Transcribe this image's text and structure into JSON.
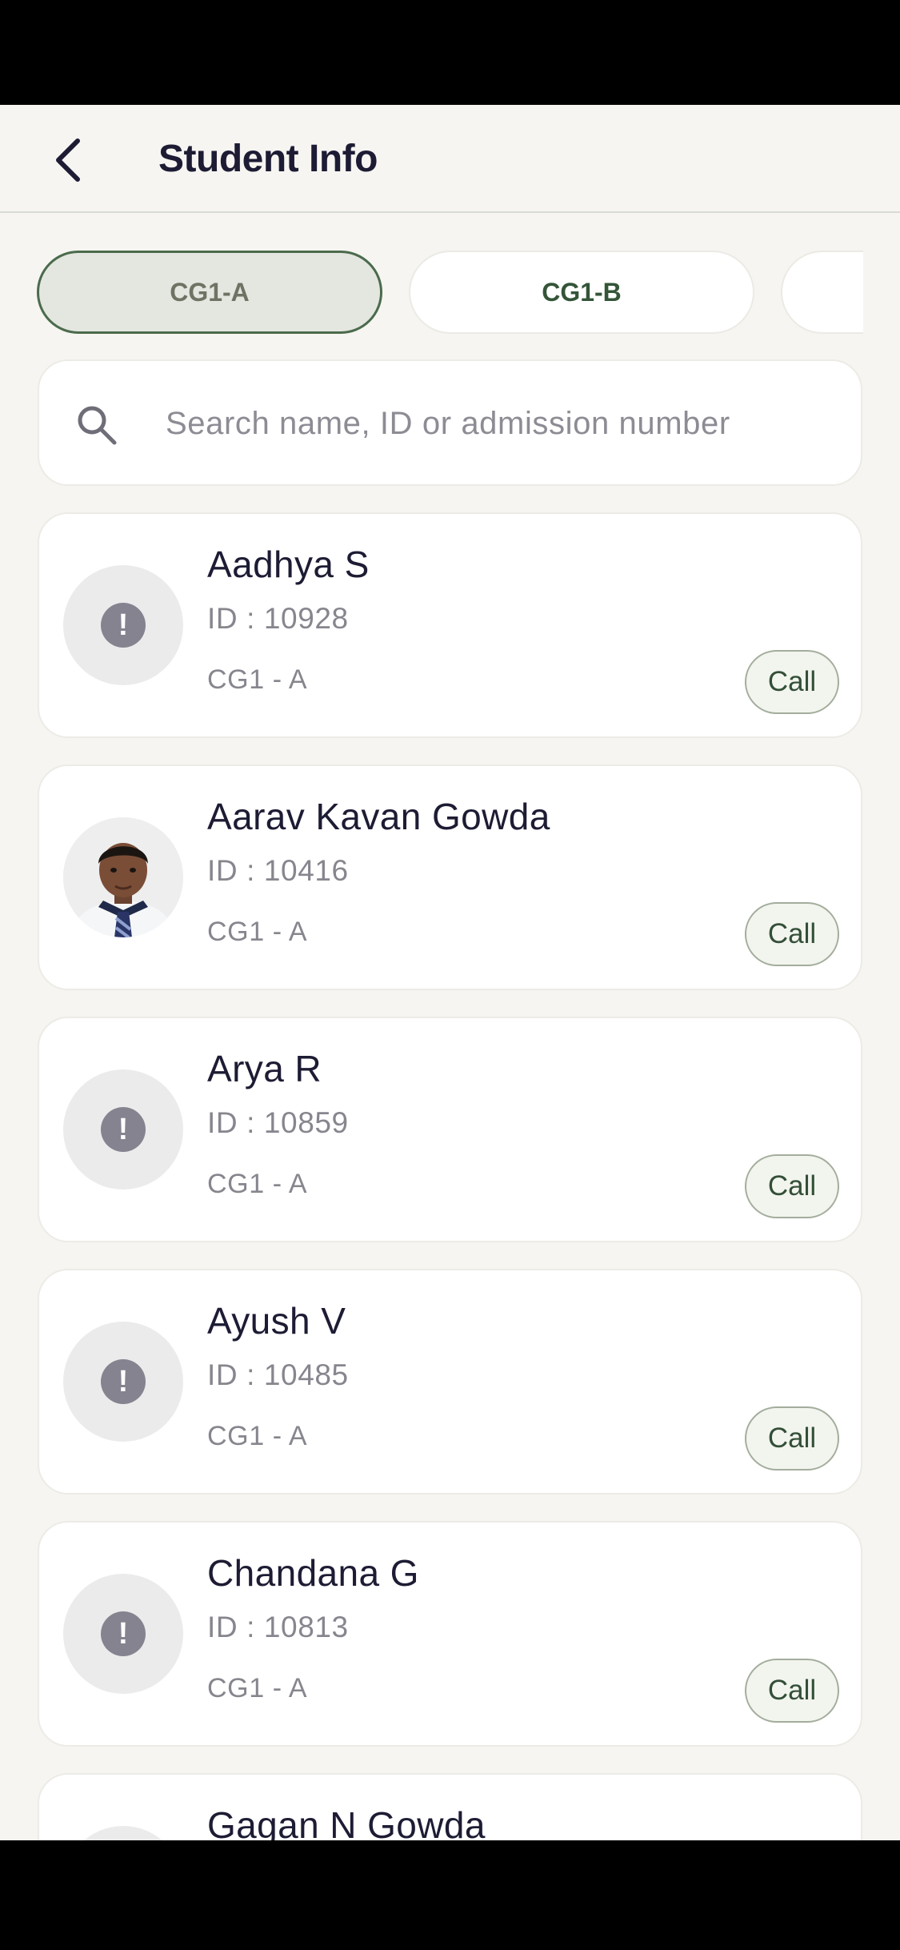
{
  "header": {
    "title": "Student Info",
    "back_icon": "chevron-left-icon"
  },
  "tabs": [
    {
      "label": "CG1-A",
      "selected": true
    },
    {
      "label": "CG1-B",
      "selected": false
    },
    {
      "label": "",
      "selected": false
    }
  ],
  "search": {
    "placeholder": "Search name, ID or admission number",
    "value": "",
    "icon": "search-icon"
  },
  "students": [
    {
      "name": "Aadhya S",
      "id_text": "ID : 10928",
      "class_text": "CG1 - A",
      "avatar": "alert-icon",
      "call_label": "Call"
    },
    {
      "name": "Aarav Kavan Gowda",
      "id_text": "ID : 10416",
      "class_text": "CG1 - A",
      "avatar": "photo",
      "call_label": "Call"
    },
    {
      "name": "Arya R",
      "id_text": "ID : 10859",
      "class_text": "CG1 - A",
      "avatar": "alert-icon",
      "call_label": "Call"
    },
    {
      "name": "Ayush V",
      "id_text": "ID : 10485",
      "class_text": "CG1 - A",
      "avatar": "alert-icon",
      "call_label": "Call"
    },
    {
      "name": "Chandana G",
      "id_text": "ID : 10813",
      "class_text": "CG1 - A",
      "avatar": "alert-icon",
      "call_label": "Call"
    },
    {
      "name": "Gagan N Gowda",
      "avatar": "alert-icon"
    }
  ],
  "colors": {
    "background": "#f6f5f1",
    "card": "#ffffff",
    "accent_green": "#345538",
    "title_text": "#1d1c34",
    "muted_text": "#87868e"
  }
}
